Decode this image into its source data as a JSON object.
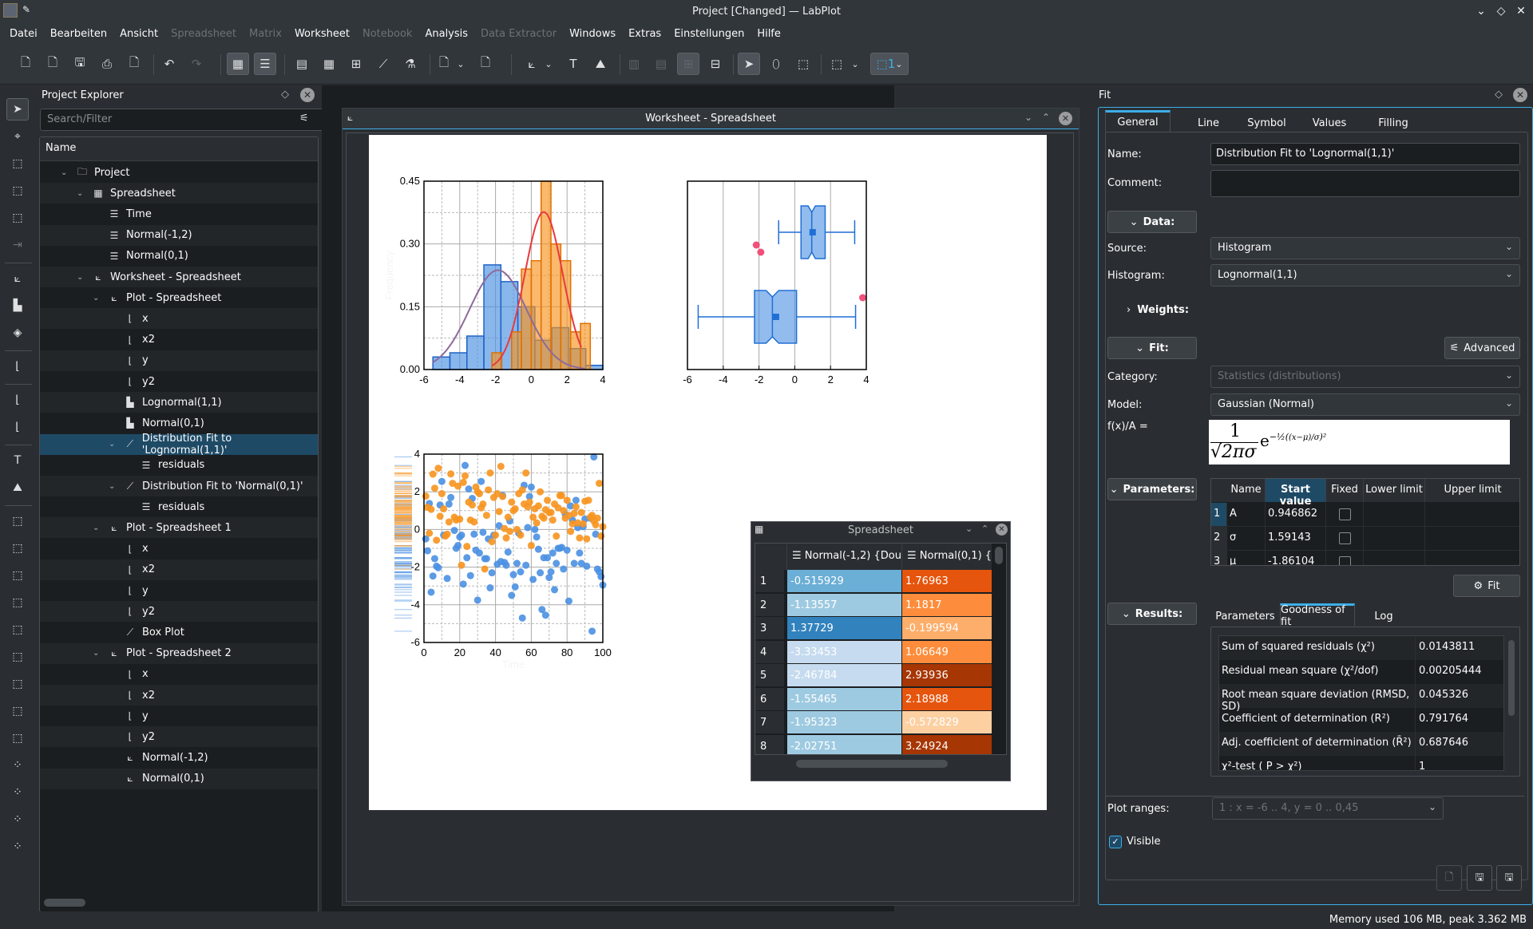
{
  "window": {
    "title": "Project [Changed] — LabPlot"
  },
  "menu": [
    "Datei",
    "Bearbeiten",
    "Ansicht",
    "Spreadsheet",
    "Matrix",
    "Worksheet",
    "Notebook",
    "Analysis",
    "Data Extractor",
    "Windows",
    "Extras",
    "Einstellungen",
    "Hilfe"
  ],
  "menu_disabled": [
    "Spreadsheet",
    "Matrix",
    "Notebook",
    "Data Extractor"
  ],
  "explorer": {
    "title": "Project Explorer",
    "search_placeholder": "Search/Filter",
    "column_header": "Name",
    "items": [
      {
        "label": "Project",
        "icon": "folder-icon",
        "level": 0,
        "expanded": true
      },
      {
        "label": "Spreadsheet",
        "icon": "spreadsheet-icon",
        "level": 1,
        "expanded": true
      },
      {
        "label": "Time",
        "icon": "column-icon",
        "level": 2
      },
      {
        "label": "Normal(-1,2)",
        "icon": "column-icon",
        "level": 2
      },
      {
        "label": "Normal(0,1)",
        "icon": "column-icon",
        "level": 2
      },
      {
        "label": "Worksheet - Spreadsheet",
        "icon": "worksheet-icon",
        "level": 1,
        "expanded": true
      },
      {
        "label": "Plot - Spreadsheet",
        "icon": "plot-icon",
        "level": 2,
        "expanded": true
      },
      {
        "label": "x",
        "icon": "x-axis-icon",
        "level": 3
      },
      {
        "label": "x2",
        "icon": "x-axis-icon",
        "level": 3
      },
      {
        "label": "y",
        "icon": "y-axis-icon",
        "level": 3
      },
      {
        "label": "y2",
        "icon": "y-axis-icon",
        "level": 3
      },
      {
        "label": "Lognormal(1,1)",
        "icon": "histogram-icon",
        "level": 3
      },
      {
        "label": "Normal(0,1)",
        "icon": "histogram-icon",
        "level": 3
      },
      {
        "label": "Distribution Fit to 'Lognormal(1,1)'",
        "icon": "fit-icon",
        "level": 3,
        "expanded": true,
        "selected": true
      },
      {
        "label": "residuals",
        "icon": "column-icon",
        "level": 4
      },
      {
        "label": "Distribution Fit to 'Normal(0,1)'",
        "icon": "fit-icon",
        "level": 3,
        "expanded": true
      },
      {
        "label": "residuals",
        "icon": "column-icon",
        "level": 4
      },
      {
        "label": "Plot - Spreadsheet 1",
        "icon": "plot-icon",
        "level": 2,
        "expanded": true
      },
      {
        "label": "x",
        "icon": "x-axis-icon",
        "level": 3
      },
      {
        "label": "x2",
        "icon": "x-axis-icon",
        "level": 3
      },
      {
        "label": "y",
        "icon": "y-axis-icon",
        "level": 3
      },
      {
        "label": "y2",
        "icon": "y-axis-icon",
        "level": 3
      },
      {
        "label": "Box Plot",
        "icon": "boxplot-icon",
        "level": 3
      },
      {
        "label": "Plot - Spreadsheet 2",
        "icon": "plot-icon",
        "level": 2,
        "expanded": true
      },
      {
        "label": "x",
        "icon": "x-axis-icon",
        "level": 3
      },
      {
        "label": "x2",
        "icon": "x-axis-icon",
        "level": 3
      },
      {
        "label": "y",
        "icon": "y-axis-icon",
        "level": 3
      },
      {
        "label": "y2",
        "icon": "y-axis-icon",
        "level": 3
      },
      {
        "label": "Normal(-1,2)",
        "icon": "xy-curve-icon",
        "level": 3
      },
      {
        "label": "Normal(0,1)",
        "icon": "xy-curve-icon",
        "level": 3
      }
    ]
  },
  "worksheet": {
    "title": "Worksheet - Spreadsheet"
  },
  "colors": {
    "blue": "#4a90e2",
    "orange": "#f7931e",
    "red": "#e8393f",
    "purple": "#8e6a9b",
    "outlier": "#f0507a",
    "accent": "#3daee9"
  },
  "chart_data": [
    {
      "type": "bar",
      "subtype": "histogram",
      "title": "",
      "xlabel": "",
      "ylabel": "Frequency",
      "xlim": [
        -6,
        4
      ],
      "ylim": [
        0,
        0.45
      ],
      "xticks": [
        "-6",
        "-4",
        "-2",
        "0",
        "2",
        "4"
      ],
      "yticks": [
        "0.00",
        "0.15",
        "0.30",
        "0.45"
      ],
      "grid": true,
      "series": [
        {
          "name": "Normal(-1,2)",
          "color": "#4a90e2",
          "bin_edges": [
            -5.5,
            -4.55,
            -3.6,
            -2.65,
            -1.7,
            -0.75,
            0.2,
            1.15,
            2.1,
            3.05,
            4.0
          ],
          "values": [
            0.03,
            0.04,
            0.08,
            0.25,
            0.21,
            0.15,
            0.07,
            0.1,
            0.05,
            0.01
          ]
        },
        {
          "name": "Normal(0,1)",
          "color": "#f7931e",
          "bin_edges": [
            -2.2,
            -1.65,
            -1.1,
            -0.55,
            0.0,
            0.55,
            1.1,
            1.65,
            2.2,
            2.75,
            3.3
          ],
          "values": [
            0.04,
            0.0,
            0.09,
            0.24,
            0.26,
            0.45,
            0.3,
            0.26,
            0.09,
            0.11
          ]
        }
      ],
      "fit_curves": [
        {
          "name": "Distribution Fit to 'Lognormal(1,1)'",
          "color": "#8e6a9b",
          "model": "gaussian",
          "A": 0.946862,
          "sigma": 1.59143,
          "mu": -1.86104,
          "x_range": [
            -5.5,
            3.0
          ]
        },
        {
          "name": "Distribution Fit to 'Normal(0,1)'",
          "color": "#e8393f",
          "model": "gaussian",
          "A": 1.0,
          "sigma": 1.06,
          "mu": 0.7,
          "x_range": [
            -2.2,
            2.8
          ]
        }
      ]
    },
    {
      "type": "boxplot",
      "title": "",
      "xlim": [
        -6,
        4
      ],
      "xticks": [
        "-6",
        "-4",
        "-2",
        "0",
        "2",
        "4"
      ],
      "grid": true,
      "series": [
        {
          "name": "Normal(0,1)",
          "whisker_low": -0.9,
          "q1": 0.35,
          "median": 0.95,
          "q3": 1.7,
          "whisker_high": 3.35,
          "mean": 1.0,
          "outliers": [
            -2.15,
            -1.9
          ]
        },
        {
          "name": "Normal(-1,2)",
          "whisker_low": -5.4,
          "q1": -2.25,
          "median": -1.25,
          "q3": 0.1,
          "whisker_high": 3.4,
          "mean": -1.05,
          "outliers": [
            3.8
          ]
        }
      ]
    },
    {
      "type": "scatter",
      "title": "",
      "xlabel": "Time",
      "ylabel": "",
      "xlim": [
        0,
        100
      ],
      "ylim": [
        -6,
        4
      ],
      "xticks": [
        "0",
        "20",
        "40",
        "60",
        "80",
        "100"
      ],
      "yticks": [
        "-6",
        "-4",
        "-2",
        "0",
        "2",
        "4"
      ],
      "grid": true,
      "series": [
        {
          "name": "Normal(-1,2)",
          "color": "#4a90e2",
          "x": [
            1,
            2,
            3,
            4,
            5,
            6,
            7,
            8,
            9,
            10,
            11,
            13,
            14,
            15,
            17,
            18,
            19,
            20,
            21,
            22,
            23,
            24,
            25,
            26,
            27,
            28,
            29,
            30,
            31,
            32,
            33,
            34,
            35,
            36,
            37,
            38,
            39,
            41,
            42,
            43,
            44,
            45,
            46,
            47,
            48,
            49,
            50,
            51,
            52,
            53,
            54,
            55,
            56,
            57,
            58,
            59,
            60,
            61,
            62,
            63,
            64,
            65,
            66,
            67,
            68,
            69,
            70,
            71,
            72,
            73,
            74,
            75,
            76,
            77,
            78,
            79,
            80,
            81,
            82,
            83,
            84,
            85,
            86,
            87,
            88,
            89,
            90,
            91,
            93,
            94,
            95,
            96,
            97,
            98,
            99,
            100
          ],
          "y": [
            -0.5,
            -1.13,
            1.38,
            -3.33,
            -2.47,
            -1.55,
            -1.95,
            -2.03,
            1.3,
            2.55,
            -0.3,
            -2.6,
            1.35,
            1.7,
            -0.05,
            -1.0,
            -0.85,
            -0.4,
            -0.3,
            -2.9,
            3.4,
            -1.5,
            2.15,
            -2.45,
            1.65,
            -0.25,
            -1.1,
            -3.75,
            -1.25,
            2.55,
            -0.15,
            -1.55,
            -1.55,
            -0.5,
            -3.1,
            -2.3,
            -0.3,
            -1.85,
            0.2,
            -1.7,
            1.8,
            -1.75,
            -1.9,
            -1.2,
            0.45,
            -3.5,
            -2.4,
            -3.05,
            -1.8,
            -0.2,
            -2.25,
            -4.7,
            2.35,
            -1.9,
            0.1,
            1.75,
            2.25,
            -2.65,
            0.0,
            -0.4,
            -1.05,
            -2.3,
            -4.25,
            -1.5,
            -4.55,
            -1.5,
            -2.55,
            -2.25,
            -1.25,
            -3.2,
            -1.8,
            -1.0,
            -1.0,
            -0.95,
            -2.1,
            0.8,
            -1.1,
            -3.8,
            1.25,
            0.5,
            -1.8,
            1.55,
            0.1,
            -1.25,
            -1.8,
            0.15,
            0.55,
            -1.95,
            0.6,
            -5.4,
            3.85,
            -0.25,
            -2.1,
            -2.25,
            -2.5,
            -2.95
          ]
        },
        {
          "name": "Normal(0,1)",
          "color": "#f7931e",
          "x": [
            1,
            2,
            3,
            4,
            5,
            6,
            7,
            8,
            9,
            10,
            11,
            12,
            13,
            14,
            15,
            16,
            17,
            18,
            19,
            20,
            21,
            22,
            23,
            24,
            25,
            26,
            27,
            28,
            29,
            30,
            31,
            32,
            33,
            34,
            35,
            36,
            37,
            38,
            39,
            40,
            41,
            42,
            43,
            44,
            45,
            46,
            47,
            48,
            49,
            50,
            51,
            52,
            53,
            54,
            55,
            56,
            57,
            58,
            59,
            60,
            61,
            62,
            63,
            64,
            65,
            66,
            67,
            68,
            69,
            70,
            71,
            72,
            73,
            74,
            75,
            76,
            77,
            78,
            79,
            80,
            81,
            82,
            83,
            84,
            85,
            86,
            87,
            88,
            89,
            90,
            91,
            92,
            93,
            94,
            95,
            96,
            97,
            98,
            99,
            100
          ],
          "y": [
            1.77,
            1.18,
            -0.2,
            1.07,
            2.94,
            2.19,
            -0.57,
            3.25,
            0.7,
            1.9,
            1.1,
            -0.35,
            -0.25,
            0.4,
            2.95,
            2.45,
            0.65,
            0.5,
            2.3,
            0.55,
            -1.9,
            2.5,
            2.85,
            -0.9,
            1.45,
            0.5,
            1.3,
            0.4,
            2.25,
            2.0,
            1.9,
            1.15,
            1.35,
            -2.1,
            0.75,
            2.1,
            3.0,
            -0.65,
            1.7,
            -0.3,
            1.9,
            0.95,
            3.35,
            1.75,
            0.05,
            -0.45,
            0.65,
            -0.1,
            1.45,
            1.0,
            1.1,
            0.0,
            1.9,
            -0.3,
            2.1,
            1.35,
            3.0,
            1.2,
            1.45,
            -0.85,
            0.65,
            1.1,
            0.35,
            1.25,
            2.0,
            0.7,
            0.6,
            1.05,
            1.55,
            0.9,
            0.9,
            0.5,
            1.35,
            -0.35,
            1.15,
            1.8,
            1.8,
            1.0,
            0.6,
            1.55,
            0.75,
            -0.1,
            0.3,
            0.85,
            1.2,
            0.35,
            -0.45,
            0.9,
            0.3,
            1.5,
            -0.5,
            1.55,
            0.65,
            0.75,
            0.45,
            0.25,
            0.6,
            2.45,
            -0.35,
            0.15
          ]
        }
      ]
    }
  ],
  "spreadsheet_view": {
    "title": "Spreadsheet",
    "columns": [
      "Normal(-1,2) {Dou",
      "Normal(0,1) {"
    ],
    "rows": [
      {
        "n": "1",
        "a": "-0.515929",
        "b": "1.76963",
        "ca": "#6baed6",
        "cb": "#e6550d"
      },
      {
        "n": "2",
        "a": "-1.13557",
        "b": "1.1817",
        "ca": "#9ecae1",
        "cb": "#fd8d3c"
      },
      {
        "n": "3",
        "a": "1.37729",
        "b": "-0.199594",
        "ca": "#3182bd",
        "cb": "#fdae6b"
      },
      {
        "n": "4",
        "a": "-3.33453",
        "b": "1.06649",
        "ca": "#c6dbef",
        "cb": "#fd8d3c"
      },
      {
        "n": "5",
        "a": "-2.46784",
        "b": "2.93936",
        "ca": "#c6dbef",
        "cb": "#a63603"
      },
      {
        "n": "6",
        "a": "-1.55465",
        "b": "2.18988",
        "ca": "#9ecae1",
        "cb": "#e6550d"
      },
      {
        "n": "7",
        "a": "-1.95323",
        "b": "-0.572829",
        "ca": "#9ecae1",
        "cb": "#fdd0a2"
      },
      {
        "n": "8",
        "a": "-2.02751",
        "b": "3.24924",
        "ca": "#9ecae1",
        "cb": "#a63603"
      }
    ]
  },
  "fit": {
    "panel_title": "Fit",
    "tabs": [
      "General",
      "Line",
      "Symbol",
      "Values",
      "Filling"
    ],
    "name_label": "Name:",
    "name_value": "Distribution Fit to 'Lognormal(1,1)'",
    "comment_label": "Comment:",
    "comment_value": "",
    "data_section": "Data:",
    "source_label": "Source:",
    "source_value": "Histogram",
    "histogram_label": "Histogram:",
    "histogram_value": "Lognormal(1,1)",
    "weights_section": "Weights:",
    "fit_section": "Fit:",
    "advanced_button": "Advanced",
    "category_label": "Category:",
    "category_value": "Statistics (distributions)",
    "model_label": "Model:",
    "model_value": "Gaussian (Normal)",
    "formula_label": "f(x)/A =",
    "parameters_section": "Parameters:",
    "param_headers": [
      "Name",
      "Start value",
      "Fixed",
      "Lower limit",
      "Upper limit"
    ],
    "params": [
      {
        "n": "1",
        "name": "A",
        "start": "0.946862",
        "fixed": false
      },
      {
        "n": "2",
        "name": "σ",
        "start": "1.59143",
        "fixed": false
      },
      {
        "n": "3",
        "name": "μ",
        "start": "-1.86104",
        "fixed": false
      }
    ],
    "fit_button": "Fit",
    "results_section": "Results:",
    "result_tabs": [
      "Parameters",
      "Goodness of fit",
      "Log"
    ],
    "goodness": [
      {
        "label": "Sum of squared residuals (χ²)",
        "value": "0.0143811"
      },
      {
        "label": "Residual mean square (χ²/dof)",
        "value": "0.00205444"
      },
      {
        "label": "Root mean square deviation (RMSD, SD)",
        "value": "0.045326"
      },
      {
        "label": "Coefficient of determination (R²)",
        "value": "0.791764"
      },
      {
        "label": "Adj. coefficient of determination (R̄²)",
        "value": "0.687646"
      },
      {
        "label": "χ²-test ( P > χ²)",
        "value": "1"
      }
    ],
    "plot_ranges_label": "Plot ranges:",
    "plot_ranges_value": "1 : x = -6 .. 4, y = 0 .. 0,45",
    "visible_label": "Visible",
    "visible": true
  },
  "status": {
    "memory": "Memory used 106 MB, peak 3.362 MB"
  }
}
